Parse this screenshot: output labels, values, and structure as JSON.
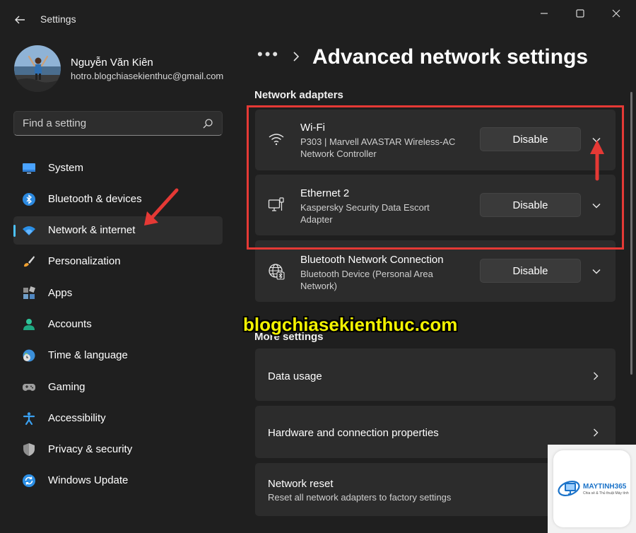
{
  "window": {
    "title": "Settings",
    "icons": {
      "back": "back-arrow-icon",
      "minimize": "minimize-icon",
      "maximize": "maximize-icon",
      "close": "close-icon"
    }
  },
  "profile": {
    "name": "Nguyễn Văn Kiên",
    "email": "hotro.blogchiasekienthuc@gmail.com"
  },
  "search": {
    "placeholder": "Find a setting"
  },
  "sidebar": {
    "items": [
      {
        "label": "System",
        "icon": "display-icon",
        "selected": false
      },
      {
        "label": "Bluetooth & devices",
        "icon": "bluetooth-icon",
        "selected": false
      },
      {
        "label": "Network & internet",
        "icon": "wifi-icon",
        "selected": true
      },
      {
        "label": "Personalization",
        "icon": "brush-icon",
        "selected": false
      },
      {
        "label": "Apps",
        "icon": "apps-icon",
        "selected": false
      },
      {
        "label": "Accounts",
        "icon": "person-icon",
        "selected": false
      },
      {
        "label": "Time & language",
        "icon": "globe-clock-icon",
        "selected": false
      },
      {
        "label": "Gaming",
        "icon": "gamepad-icon",
        "selected": false
      },
      {
        "label": "Accessibility",
        "icon": "accessibility-icon",
        "selected": false
      },
      {
        "label": "Privacy & security",
        "icon": "shield-icon",
        "selected": false
      },
      {
        "label": "Windows Update",
        "icon": "update-icon",
        "selected": false
      }
    ]
  },
  "header": {
    "breadcrumb_more": "•••",
    "title": "Advanced network settings"
  },
  "network_adapters": {
    "section_title": "Network adapters",
    "adapters": [
      {
        "name": "Wi-Fi",
        "description_line1": "P303 | Marvell AVASTAR Wireless-AC",
        "description_line2": "Network Controller",
        "button": "Disable",
        "icon": "wifi-icon"
      },
      {
        "name": "Ethernet 2",
        "description_line1": "Kaspersky Security Data Escort",
        "description_line2": "Adapter",
        "button": "Disable",
        "icon": "ethernet-icon"
      },
      {
        "name": "Bluetooth Network Connection",
        "description_line1": "Bluetooth Device (Personal Area",
        "description_line2": "Network)",
        "button": "Disable",
        "icon": "globe-icon"
      }
    ]
  },
  "more_settings": {
    "section_title": "More settings",
    "items": [
      {
        "title": "Data usage",
        "subtitle": ""
      },
      {
        "title": "Hardware and connection properties",
        "subtitle": ""
      },
      {
        "title": "Network reset",
        "subtitle": "Reset all network adapters to factory settings"
      }
    ]
  },
  "overlay": {
    "watermark": "blogchiasekienthuc.com",
    "logo_text": "MAYTINH365",
    "logo_tagline": "Chia sẻ & Thủ thuật Máy tính",
    "highlight_color": "#e53935",
    "arrow_color": "#e53935"
  },
  "colors": {
    "background": "#1f1f1f",
    "card": "#2c2c2c",
    "accent": "#4cc2ff",
    "watermark": "#f2f200"
  }
}
